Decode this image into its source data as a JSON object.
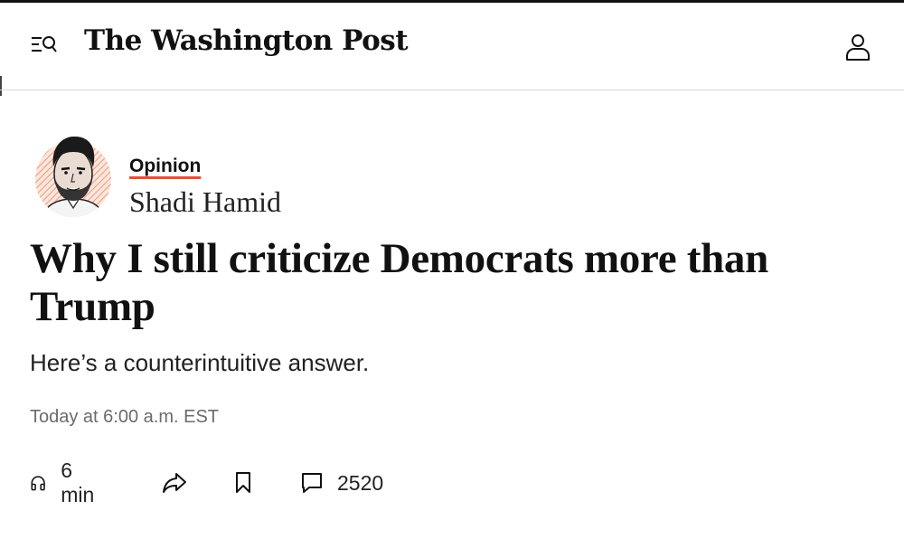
{
  "header": {
    "logo_text": "The Washington Post",
    "menu_icon": "menu-search-icon",
    "account_icon": "user-icon"
  },
  "article": {
    "section": "Opinion",
    "author": "Shadi Hamid",
    "headline": "Why I still criticize Democrats more than Trump",
    "dek": "Here’s a counterintuitive answer.",
    "timestamp": "Today at 6:00 a.m. EST"
  },
  "actions": {
    "listen_label": "6 min",
    "listen_icon": "headphones-icon",
    "share_icon": "share-icon",
    "save_icon": "bookmark-icon",
    "comments_icon": "comment-icon",
    "comments_count": "2520"
  },
  "colors": {
    "accent_underline": "#e0533b",
    "avatar_ring": "#f2b9a6",
    "text": "#111111",
    "muted": "#6b6b6b"
  }
}
